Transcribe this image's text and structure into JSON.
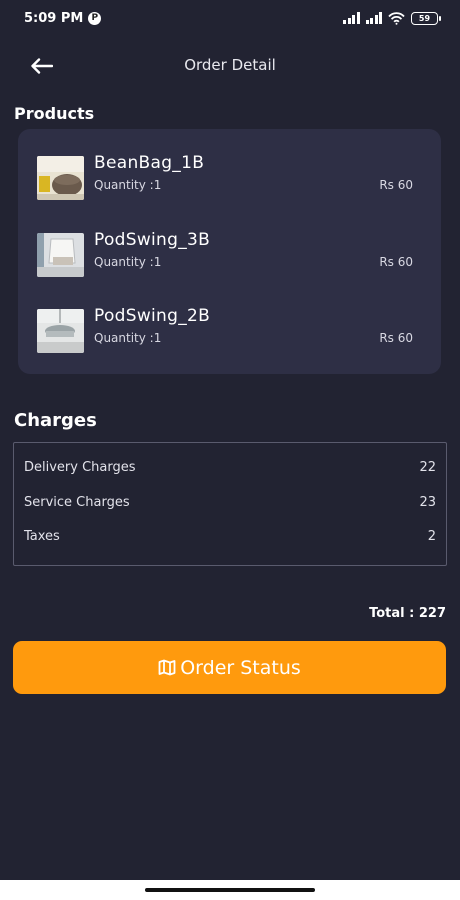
{
  "status_bar": {
    "time": "5:09 PM",
    "app_badge": "P",
    "battery": "59"
  },
  "header": {
    "title": "Order Detail"
  },
  "products": {
    "title": "Products",
    "items": [
      {
        "name": "BeanBag_1B",
        "quantity": "Quantity :1",
        "price": "Rs 60"
      },
      {
        "name": "PodSwing_3B",
        "quantity": "Quantity :1",
        "price": "Rs 60"
      },
      {
        "name": "PodSwing_2B",
        "quantity": "Quantity :1",
        "price": "Rs 60"
      }
    ]
  },
  "charges": {
    "title": "Charges",
    "rows": [
      {
        "label": "Delivery Charges",
        "value": "22"
      },
      {
        "label": "Service Charges",
        "value": "23"
      },
      {
        "label": "Taxes",
        "value": "2"
      }
    ]
  },
  "total": "Total : 227",
  "order_button": {
    "label": "Order Status",
    "icon": "map-icon",
    "color": "#ff9a0d"
  },
  "colors": {
    "background": "#222332",
    "card": "#2e2f45",
    "accent": "#ff9a0d"
  }
}
